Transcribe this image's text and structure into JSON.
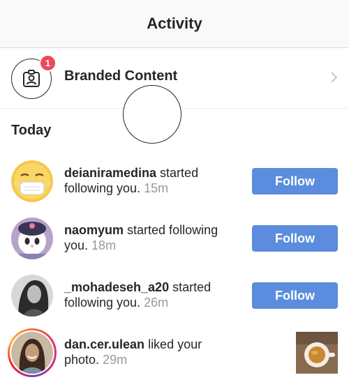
{
  "header": {
    "title": "Activity"
  },
  "branded": {
    "label": "Branded Content",
    "badge_count": "1",
    "icon": "person-frame-icon"
  },
  "section": {
    "title": "Today"
  },
  "notifications": [
    {
      "username": "deianiramedina",
      "text_a": " started",
      "text_b": "following you.",
      "time": "15m",
      "action": "Follow"
    },
    {
      "username": "naomyum",
      "text_a": " started following",
      "text_b": "you.",
      "time": "18m",
      "action": "Follow"
    },
    {
      "username": "_mohadeseh_a20",
      "text_a": " started",
      "text_b": "following you.",
      "time": "26m",
      "action": "Follow"
    },
    {
      "username": "dan.cer.ulean",
      "text_a": " liked your",
      "text_b": "photo.",
      "time": "29m"
    }
  ],
  "colors": {
    "follow_button": "#5b8cdd",
    "badge": "#ed4956",
    "timestamp": "#999999"
  }
}
